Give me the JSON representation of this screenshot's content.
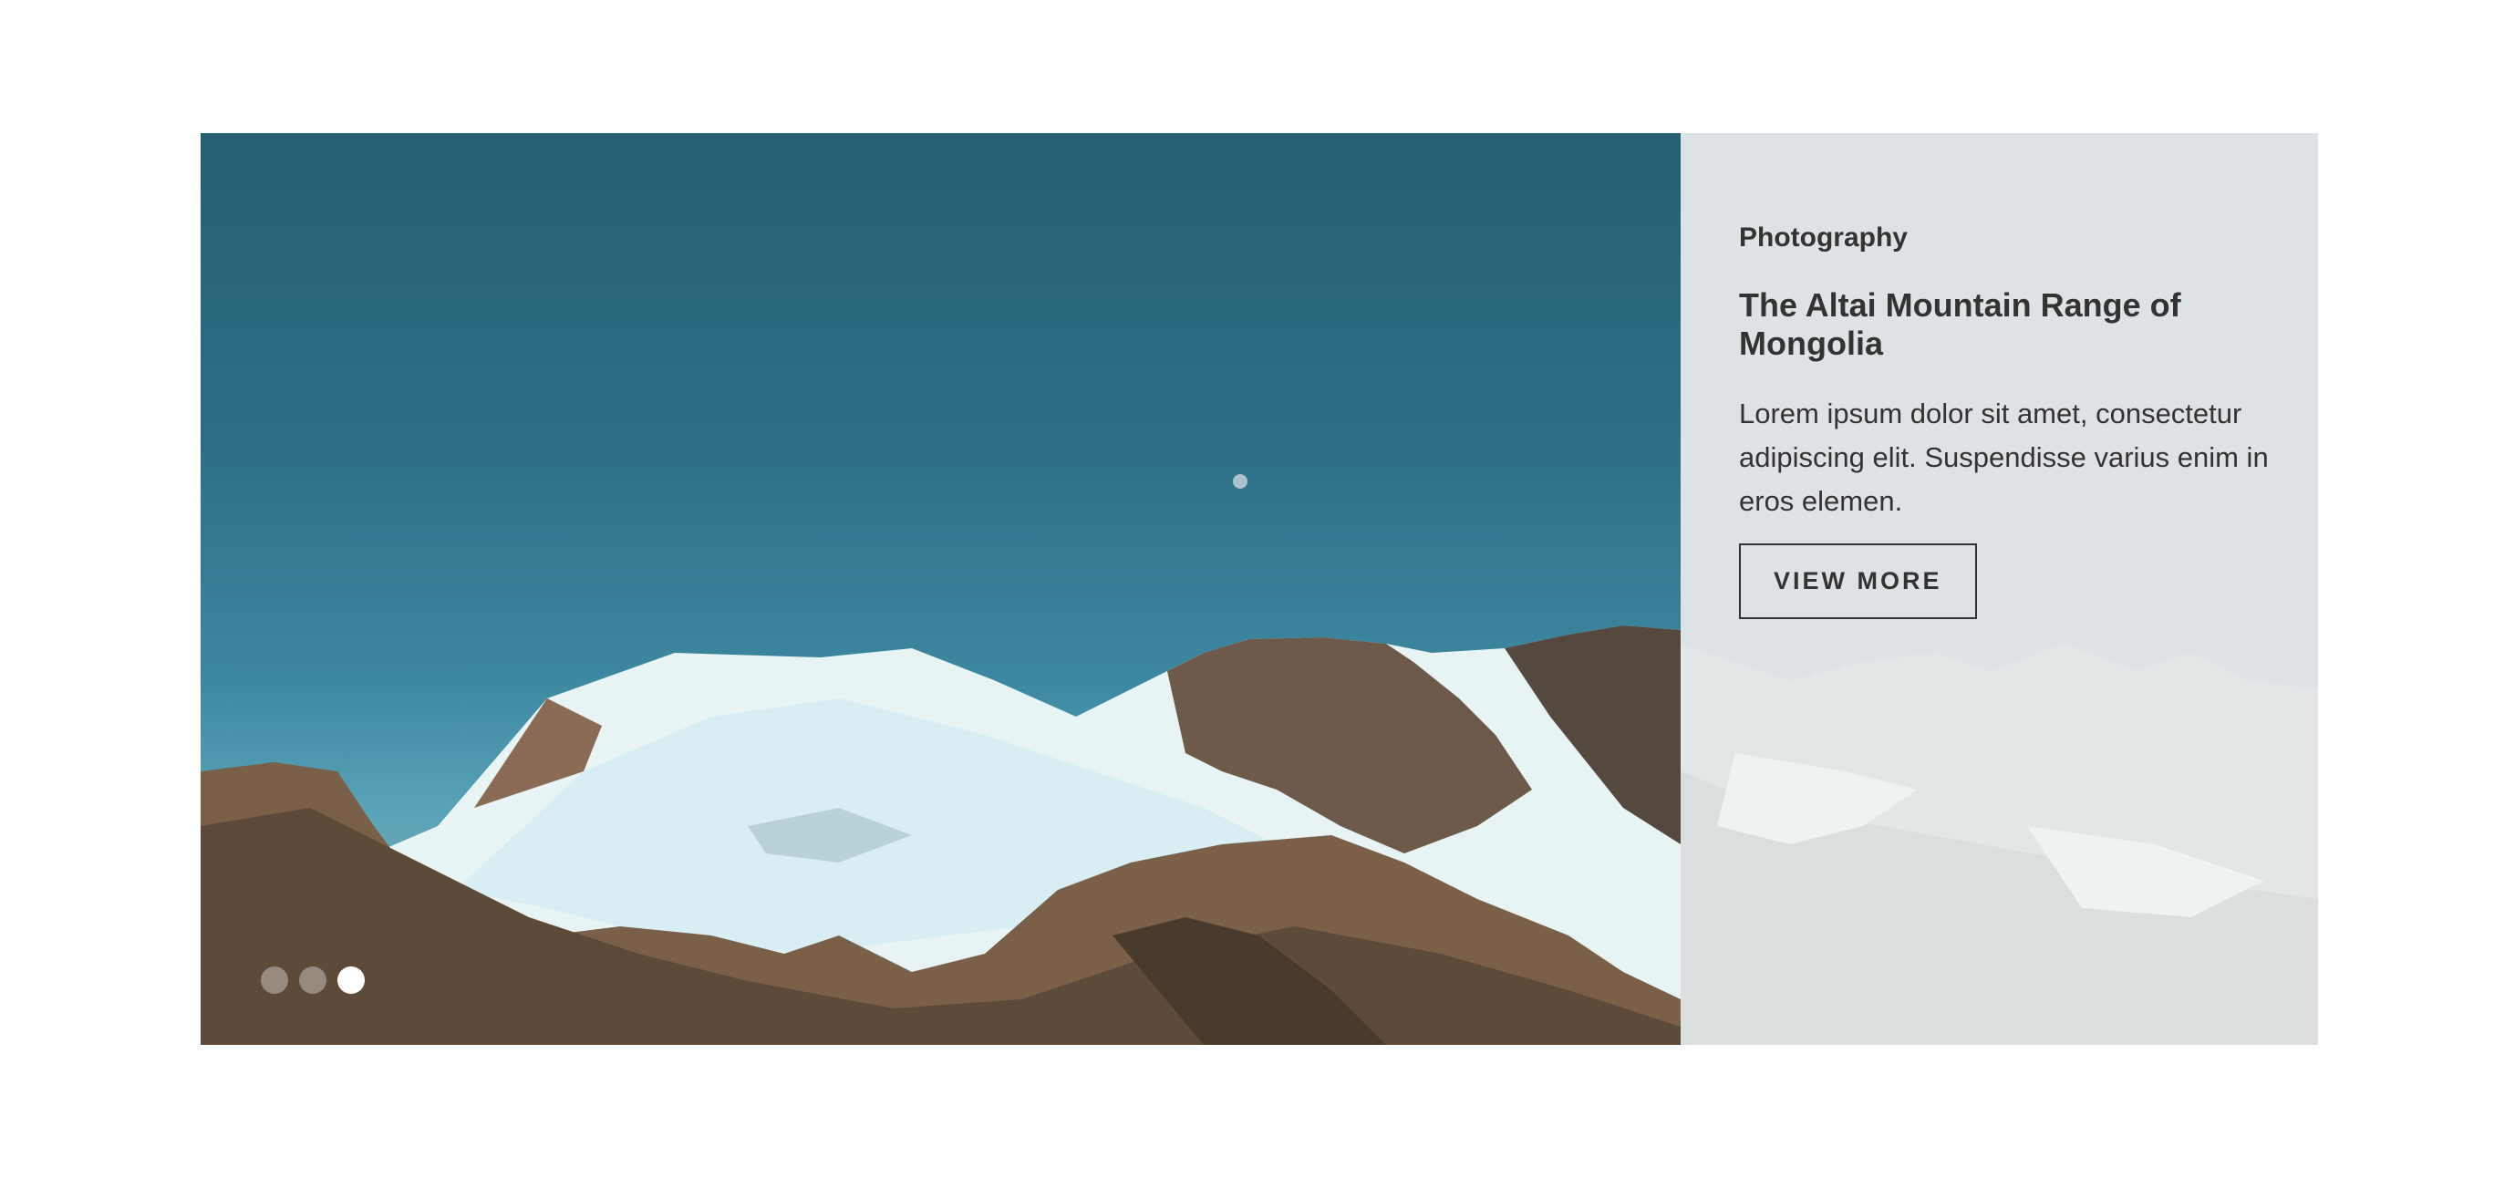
{
  "slide": {
    "category": "Photography",
    "title": "The Altai Mountain Range of Mongolia",
    "description": "Lorem ipsum dolor sit amet, consectetur adipiscing elit. Suspendisse varius enim in eros elemen.",
    "button_label": "VIEW MORE",
    "image_subject": "snow-capped mountains under blue sky with moon"
  },
  "carousel": {
    "slide_count": 3,
    "active_index": 2
  },
  "colors": {
    "panel_bg": "#dde3e5",
    "text": "#333333",
    "sky_top": "#255f74",
    "sky_bottom": "#5aa4b8",
    "dot_active": "#ffffff"
  }
}
